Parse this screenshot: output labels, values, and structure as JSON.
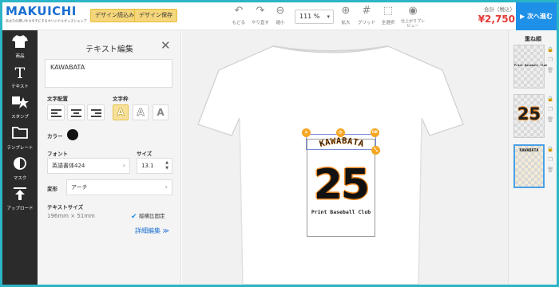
{
  "header": {
    "logo": "MAKUICHI",
    "logo_tagline": "あなたの想いをカタチにするオリジナルグッズショップ",
    "load_design_label": "デザイン読込み",
    "save_design_label": "デザイン保存",
    "tools": [
      {
        "icon": "undo-icon",
        "label": "もどる"
      },
      {
        "icon": "redo-icon",
        "label": "やり直す"
      },
      {
        "icon": "zoom-out-icon",
        "label": "縮小"
      },
      {
        "icon": "zoom-in-icon",
        "label": "拡大"
      },
      {
        "icon": "grid-icon",
        "label": "グリッド"
      },
      {
        "icon": "select-all-icon",
        "label": "全選択"
      },
      {
        "icon": "preview-icon",
        "label": "仕上がりプレビュー"
      }
    ],
    "zoom_value": "111 %",
    "total_label": "合計（税込）",
    "total_value": "¥2,750",
    "next_label": "▶ 次へ進む",
    "accent_color": "#1e90e8",
    "price_color": "#e53935"
  },
  "sidebar": {
    "items": [
      {
        "icon": "tshirt-icon",
        "label": "商品"
      },
      {
        "icon": "text-icon",
        "label": "テキスト"
      },
      {
        "icon": "stamp-icon",
        "label": "スタンプ"
      },
      {
        "icon": "folder-icon",
        "label": "テンプレート"
      },
      {
        "icon": "mask-icon",
        "label": "マスク"
      },
      {
        "icon": "upload-icon",
        "label": "アップロード"
      }
    ]
  },
  "text_panel": {
    "title": "テキスト編集",
    "text_value": "KAWABATA",
    "align_label": "文字配置",
    "style_label": "文字枠",
    "color_label": "カラー",
    "font_label": "フォント",
    "font_value": "英語書体424",
    "size_label": "サイズ",
    "size_value": "13.1",
    "transform_label": "変形",
    "transform_value": "アーチ",
    "text_size_label": "テキストサイズ",
    "text_size_value": "196mm × 51mm",
    "lock_ratio_label": "縦横比固定",
    "detail_label": "詳細編集 ≫",
    "selected_color": "#111111"
  },
  "canvas": {
    "arch_text": "KAWABATA",
    "number": "25",
    "team": "Print Baseball Club",
    "handle_labels": [
      "✕",
      "⟳",
      "OK",
      "⤡"
    ],
    "outline_color": "#f08a24"
  },
  "layers": {
    "title": "重ね順",
    "items": [
      {
        "text": "Print Baseball Club"
      },
      {
        "text": "25"
      },
      {
        "text": "KAWABATA"
      }
    ]
  }
}
